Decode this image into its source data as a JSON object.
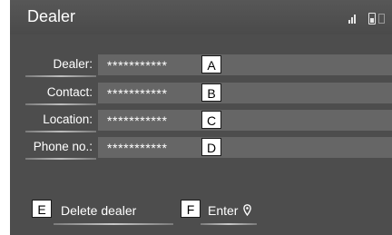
{
  "header": {
    "title": "Dealer"
  },
  "status_icons": [
    "signal-icon",
    "battery-icon",
    "phone-icon"
  ],
  "fields": [
    {
      "label": "Dealer:",
      "value": "***********",
      "callout": "A"
    },
    {
      "label": "Contact:",
      "value": "***********",
      "callout": "B"
    },
    {
      "label": "Location:",
      "value": "***********",
      "callout": "C"
    },
    {
      "label": "Phone no.:",
      "value": "***********",
      "callout": "D"
    }
  ],
  "buttons": {
    "delete": {
      "label": "Delete dealer",
      "callout": "E"
    },
    "enter": {
      "label": "Enter",
      "callout": "F",
      "icon": "map-pin-icon"
    }
  },
  "colors": {
    "screen_bg": "#4d4d4d",
    "field_bg": "#666666",
    "text": "#ffffff"
  }
}
